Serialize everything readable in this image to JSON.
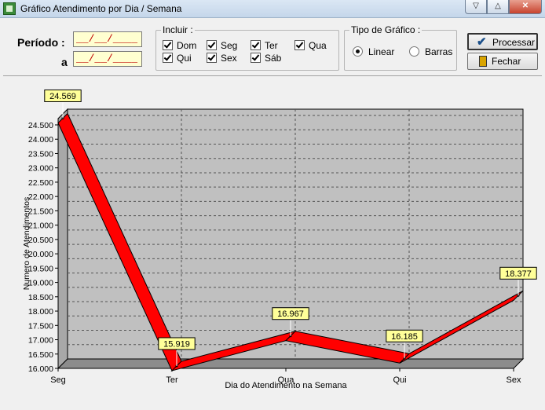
{
  "window": {
    "title": "Gráfico Atendimento por Dia / Semana"
  },
  "window_buttons": {
    "minimize": "▽",
    "maximize": "△",
    "close": "✕"
  },
  "filters": {
    "periodo_label": "Período :",
    "a_label": "a",
    "date_from": "__/__/____",
    "date_to": "__/__/____"
  },
  "incluir": {
    "title": "Incluir :",
    "days": [
      {
        "label": "Dom",
        "checked": true
      },
      {
        "label": "Seg",
        "checked": true
      },
      {
        "label": "Ter",
        "checked": true
      },
      {
        "label": "Qua",
        "checked": true
      },
      {
        "label": "Qui",
        "checked": true
      },
      {
        "label": "Sex",
        "checked": true
      },
      {
        "label": "Sáb",
        "checked": true
      }
    ]
  },
  "tipo": {
    "title": "Tipo de Gráfico :",
    "options": [
      {
        "label": "Linear",
        "selected": true
      },
      {
        "label": "Barras",
        "selected": false
      }
    ]
  },
  "buttons": {
    "process": "Processar",
    "close": "Fechar"
  },
  "chart_data": {
    "type": "line",
    "categories": [
      "Seg",
      "Ter",
      "Qua",
      "Qui",
      "Sex"
    ],
    "values": [
      24569,
      15919,
      16967,
      16185,
      18377
    ],
    "value_labels": [
      "24.569",
      "15.919",
      "16.967",
      "16.185",
      "18.377"
    ],
    "xlabel": "Dia do Atendimento na Semana",
    "ylabel": "Numero de Atendimentos",
    "ylim": [
      16000,
      24500
    ],
    "yticks": [
      16000,
      16500,
      17000,
      17500,
      18000,
      18500,
      19000,
      19500,
      20000,
      20500,
      21000,
      21500,
      22000,
      22500,
      23000,
      23500,
      24000,
      24500
    ],
    "ytick_labels": [
      "16.000",
      "16.500",
      "17.000",
      "17.500",
      "18.000",
      "18.500",
      "19.000",
      "19.500",
      "20.000",
      "20.500",
      "21.000",
      "21.500",
      "22.000",
      "22.500",
      "23.000",
      "23.500",
      "24.000",
      "24.500"
    ],
    "grid": true,
    "line_color": "#ff0000",
    "plot_bg": "#c0c0c0",
    "label_bg": "#ffff99"
  }
}
